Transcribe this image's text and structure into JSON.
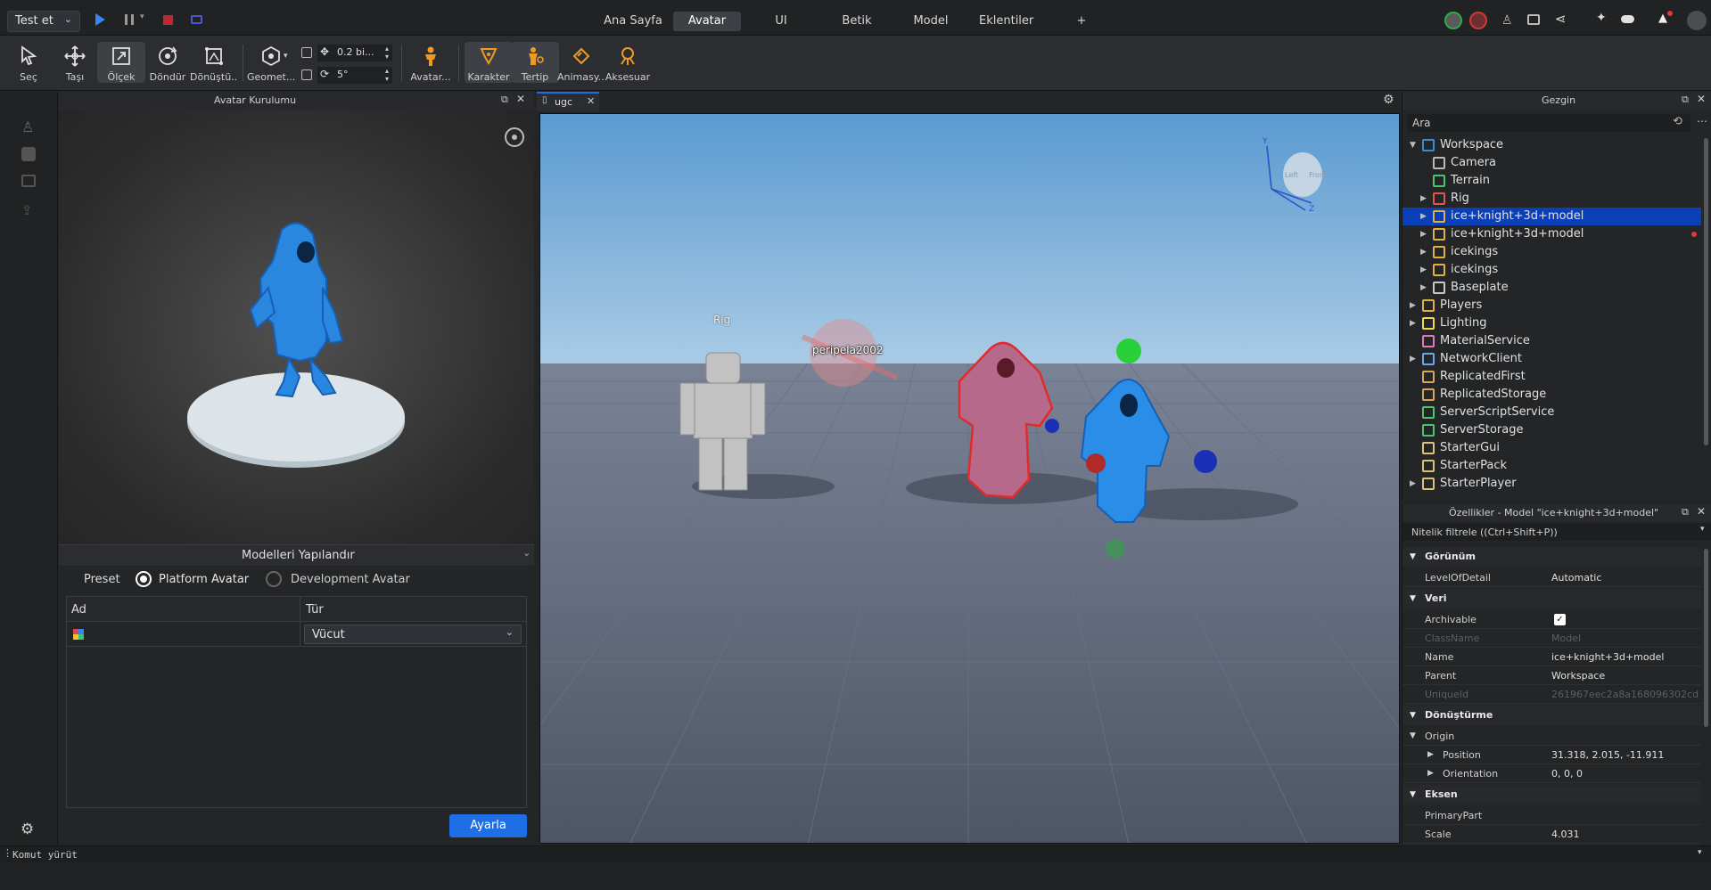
{
  "topbar": {
    "test_button": "Test et",
    "tabs": [
      "Ana Sayfa",
      "Avatar",
      "UI",
      "Betik",
      "Model",
      "Eklentiler",
      "+"
    ],
    "active_tab": "Avatar"
  },
  "toolbar": {
    "tools": [
      "Seç",
      "Taşı",
      "Ölçek",
      "Döndür",
      "Dönüştü...",
      "Geomet...",
      "Avatar...",
      "Karakter",
      "Tertip",
      "Animasy...",
      "Aksesuar"
    ],
    "move_snap": "0.2 bi...",
    "rotate_snap": "5°"
  },
  "left_panel": {
    "title": "Avatar Kurulumu",
    "configure_title": "Modelleri Yapılandır",
    "preset_label": "Preset",
    "option_platform": "Platform Avatar",
    "option_development": "Development Avatar",
    "col_name": "Ad",
    "col_type": "Tür",
    "row_type": "Vücut",
    "apply_button": "Ayarla"
  },
  "viewport": {
    "tab_label": "ugc",
    "label_rig": "Rig",
    "label_player": "peripela2002",
    "view_cube_labels": {
      "left": "Left",
      "front": "Front"
    },
    "axis_y": "Y",
    "axis_z": "Z"
  },
  "explorer": {
    "title": "Gezgin",
    "search_placeholder": "Ara",
    "items": [
      {
        "label": "Workspace",
        "depth": 0,
        "expanded": true,
        "color": "#3d8bd6"
      },
      {
        "label": "Camera",
        "depth": 1,
        "color": "#b9b9b9"
      },
      {
        "label": "Terrain",
        "depth": 1,
        "color": "#4ec46b"
      },
      {
        "label": "Rig",
        "depth": 1,
        "arrow": true,
        "color": "#e05656"
      },
      {
        "label": "ice+knight+3d+model",
        "depth": 1,
        "arrow": true,
        "selected": true,
        "color": "#e0b040"
      },
      {
        "label": "ice+knight+3d+model",
        "depth": 1,
        "arrow": true,
        "dot": true,
        "color": "#e0b040"
      },
      {
        "label": "icekings",
        "depth": 1,
        "arrow": true,
        "color": "#e0b040"
      },
      {
        "label": "icekings",
        "depth": 1,
        "arrow": true,
        "color": "#e0b040"
      },
      {
        "label": "Baseplate",
        "depth": 1,
        "arrow": true,
        "color": "#c9c9c9"
      },
      {
        "label": "Players",
        "depth": 0,
        "arrow": true,
        "color": "#e0b040"
      },
      {
        "label": "Lighting",
        "depth": 0,
        "arrow": true,
        "color": "#f2d84a"
      },
      {
        "label": "MaterialService",
        "depth": 0,
        "color": "#e07ab8"
      },
      {
        "label": "NetworkClient",
        "depth": 0,
        "arrow": true,
        "color": "#6ba8e8"
      },
      {
        "label": "ReplicatedFirst",
        "depth": 0,
        "color": "#d9a55a"
      },
      {
        "label": "ReplicatedStorage",
        "depth": 0,
        "color": "#d9a55a"
      },
      {
        "label": "ServerScriptService",
        "depth": 0,
        "color": "#4ec46b"
      },
      {
        "label": "ServerStorage",
        "depth": 0,
        "color": "#4ec46b"
      },
      {
        "label": "StarterGui",
        "depth": 0,
        "color": "#d9c27a"
      },
      {
        "label": "StarterPack",
        "depth": 0,
        "color": "#d9c27a"
      },
      {
        "label": "StarterPlayer",
        "depth": 0,
        "arrow": true,
        "color": "#d9c27a"
      }
    ]
  },
  "properties": {
    "title": "Özellikler - Model \"ice+knight+3d+model\"",
    "filter_placeholder": "Nitelik filtrele ((Ctrl+Shift+P))",
    "sections": [
      {
        "title": "Görünüm",
        "rows": [
          {
            "k": "LevelOfDetail",
            "v": "Automatic"
          }
        ]
      },
      {
        "title": "Veri",
        "rows": [
          {
            "k": "Archivable",
            "v": "",
            "checkbox": true
          },
          {
            "k": "ClassName",
            "v": "Model",
            "dim": true
          },
          {
            "k": "Name",
            "v": "ice+knight+3d+model"
          },
          {
            "k": "Parent",
            "v": "Workspace"
          },
          {
            "k": "UniqueId",
            "v": "261967eec2a8a168096302cd...",
            "dim": true
          }
        ]
      },
      {
        "title": "Dönüştürme",
        "rows": [
          {
            "k": "Origin",
            "v": "",
            "sub": true
          },
          {
            "k": "Position",
            "v": "31.318, 2.015, -11.911",
            "sub2": true
          },
          {
            "k": "Orientation",
            "v": "0, 0, 0",
            "sub2": true
          }
        ]
      },
      {
        "title": "Eksen",
        "rows": [
          {
            "k": "PrimaryPart",
            "v": ""
          },
          {
            "k": "Scale",
            "v": "4.031"
          }
        ]
      }
    ]
  },
  "command_bar": {
    "placeholder": "Komut yürüt"
  },
  "colors": {
    "accent": "#1e6ee6",
    "selection": "#0a3fb8",
    "viewport_sky": "#6ea9d6",
    "floor": "#545b6d"
  }
}
